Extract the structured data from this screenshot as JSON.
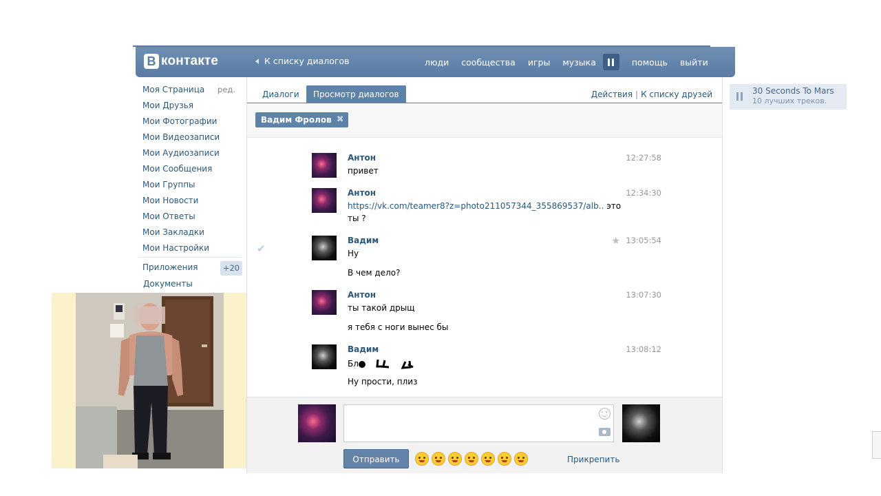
{
  "header": {
    "logo_letter": "В",
    "logo_text": "контакте",
    "back_link": "К списку диалогов",
    "nav": [
      "люди",
      "сообщества",
      "игры",
      "музыка"
    ],
    "nav_after_pause": [
      "помощь",
      "выйти"
    ]
  },
  "left_menu": {
    "edit_label": "ред.",
    "items": [
      "Моя Страница",
      "Мои Друзья",
      "Мои Фотографии",
      "Мои Видеозаписи",
      "Мои Аудиозаписи",
      "Мои Сообщения",
      "Мои Группы",
      "Мои Новости",
      "Мои Ответы",
      "Мои Закладки",
      "Мои Настройки"
    ],
    "apps_label": "Приложения",
    "apps_badge": "+20",
    "docs_label": "Документы"
  },
  "tabs": {
    "items": [
      "Диалоги",
      "Просмотр диалогов"
    ],
    "active": 1,
    "actions_label": "Действия",
    "friends_label": "К списку друзей"
  },
  "filter": {
    "person": "Вадим Фролов"
  },
  "messages": [
    {
      "author": "Антон",
      "time": "12:27:58",
      "lines": [
        "привет"
      ]
    },
    {
      "author": "Антон",
      "time": "12:34:30",
      "link": "https://vk.com/teamer8?z=photo211057344_355869537/alb..",
      "link_suffix": " это",
      "lines": [
        "ты ?"
      ]
    },
    {
      "author": "Вадим",
      "time": "13:05:54",
      "lines": [
        "Ну",
        "В чем дело?"
      ]
    },
    {
      "author": "Антон",
      "time": "13:07:30",
      "lines": [
        "ты такой дрыщ",
        "я тебя с ноги вынес бы"
      ]
    },
    {
      "author": "Вадим",
      "time": "13:08:12",
      "lines": [
        "Бл",
        "Ну прости, плиз"
      ]
    }
  ],
  "composer": {
    "send_label": "Отправить",
    "attach_label": "Прикрепить"
  },
  "audio": {
    "title": "30 Seconds To Mars",
    "subtitle": "10 лучших треков."
  },
  "colors": {
    "header_bg": "#5a7ca4",
    "link": "#2b587a",
    "tab_active": "#5e82a8"
  }
}
